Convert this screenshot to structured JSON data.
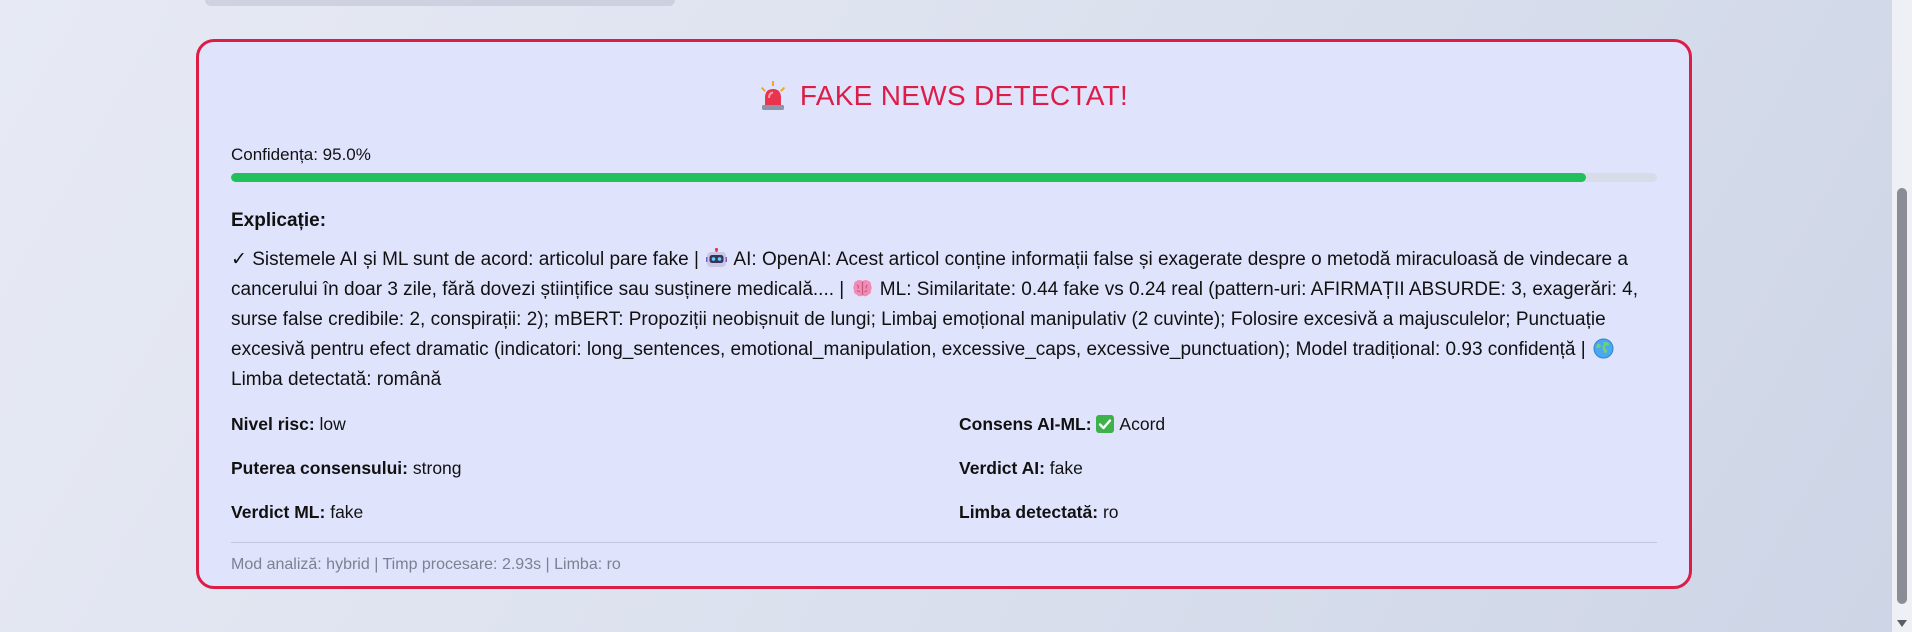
{
  "alert": {
    "title": "FAKE NEWS DETECTAT!",
    "title_icon": "siren-icon",
    "accent_color": "#dc1d48"
  },
  "confidence": {
    "label": "Confidența: 95.0%",
    "value_percent": 95.0,
    "bar_color": "#22c05b"
  },
  "explanation": {
    "heading": "Explicație:",
    "part1": "✓ Sistemele AI și ML sunt de acord: articolul pare fake | ",
    "ai_icon": "robot-icon",
    "part2": " AI: OpenAI: Acest articol conține informații false și exagerate despre o metodă miraculoasă de vindecare a cancerului în doar 3 zile, fără dovezi științifice sau susținere medicală.... | ",
    "ml_icon": "brain-icon",
    "part3": " ML: Similaritate: 0.44 fake vs 0.24 real (pattern-uri: AFIRMAȚII ABSURDE: 3, exagerări: 4, surse false credibile: 2, conspirații: 2); mBERT: Propoziții neobișnuit de lungi; Limbaj emoțional manipulativ (2 cuvinte); Folosire excesivă a majusculelor; Punctuație excesivă pentru efect dramatic (indicatori: long_sentences, emotional_manipulation, excessive_caps, excessive_punctuation); Model tradițional: 0.93 confidență | ",
    "lang_icon": "globe-icon",
    "part4": " Limba detectată: română"
  },
  "details": {
    "risk_label": "Nivel risc:",
    "risk_value": "low",
    "consensus_label": "Consens AI-ML:",
    "consensus_icon": "check-mark-icon",
    "consensus_value": "Acord",
    "strength_label": "Puterea consensului:",
    "strength_value": "strong",
    "ai_verdict_label": "Verdict AI:",
    "ai_verdict_value": "fake",
    "ml_verdict_label": "Verdict ML:",
    "ml_verdict_value": "fake",
    "language_label": "Limba detectată:",
    "language_value": "ro"
  },
  "footer": {
    "text": "Mod analiză: hybrid | Timp procesare: 2.93s | Limba: ro"
  }
}
